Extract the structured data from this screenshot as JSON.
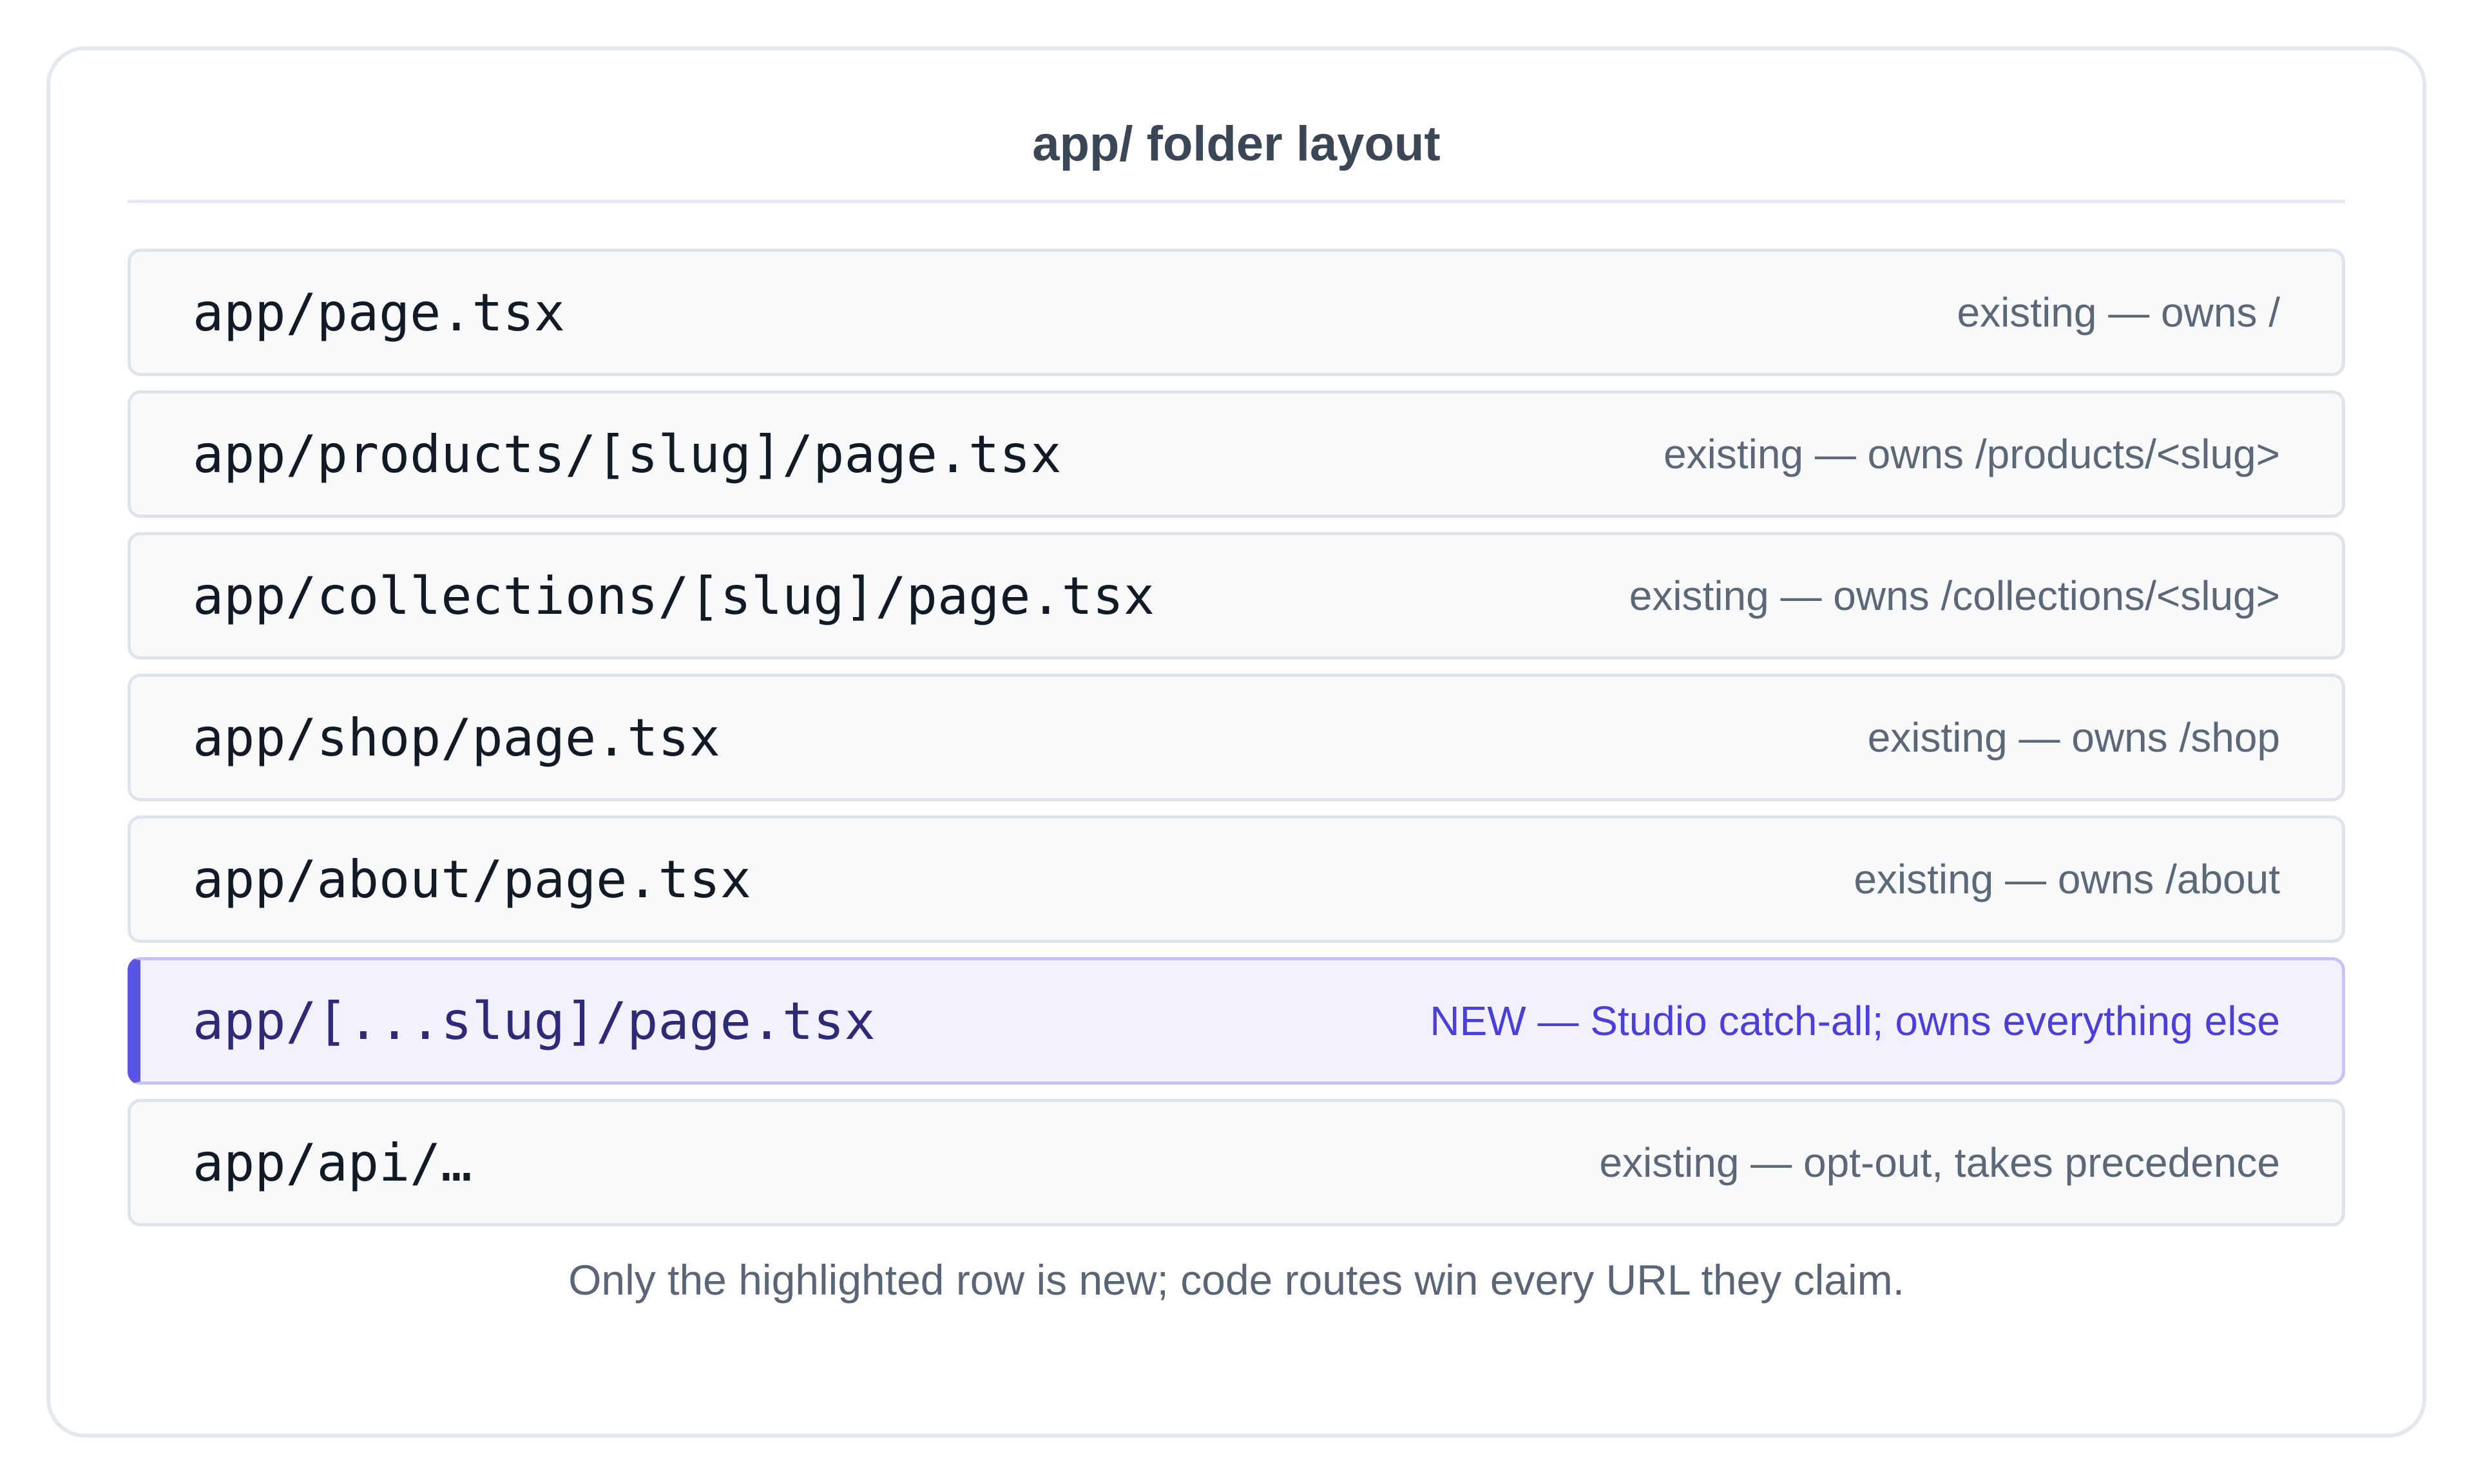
{
  "title": "app/ folder layout",
  "rows": [
    {
      "path": "app/page.tsx",
      "note": "existing — owns /",
      "highlighted": false
    },
    {
      "path": "app/products/[slug]/page.tsx",
      "note": "existing — owns /products/<slug>",
      "highlighted": false
    },
    {
      "path": "app/collections/[slug]/page.tsx",
      "note": "existing — owns /collections/<slug>",
      "highlighted": false
    },
    {
      "path": "app/shop/page.tsx",
      "note": "existing — owns /shop",
      "highlighted": false
    },
    {
      "path": "app/about/page.tsx",
      "note": "existing — owns /about",
      "highlighted": false
    },
    {
      "path": "app/[...slug]/page.tsx",
      "note": "NEW — Studio catch-all; owns everything else",
      "highlighted": true
    },
    {
      "path": "app/api/…",
      "note": "existing — opt-out, takes precedence",
      "highlighted": false
    }
  ],
  "caption": "Only the highlighted row is new; code routes win every URL they claim.",
  "colors": {
    "highlight_accent": "#5b55e6",
    "highlight_text": "#4b3fdc",
    "highlight_background": "#f4f1fe"
  }
}
